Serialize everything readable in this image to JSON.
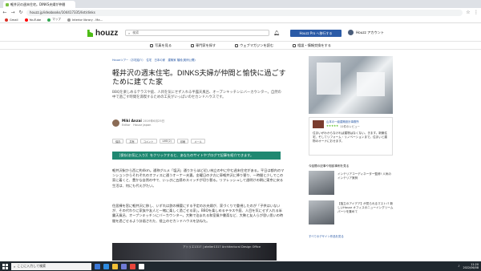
{
  "browser": {
    "tab_title": "軽井沢の週末住宅。DINKS夫婦が仲間",
    "url": "houzz.jp/ideabooks/104417335/list/dinks",
    "bookmarks": [
      "Gmail",
      "YouTube",
      "マップ",
      "Interior library - Ma..."
    ]
  },
  "header": {
    "logo": "houzz",
    "search_placeholder": "検索",
    "pro_button": "Houzz Pro へ移行する",
    "account_label": "Houzz アカウント"
  },
  "nav": {
    "items": [
      "写真を見る",
      "専門家を探す",
      "ウェブマガジンを読む",
      "相談・情報交換をする"
    ]
  },
  "article": {
    "breadcrumb": "Houzzツアー（お宅紹介）　住宅　日本の家　建築家 階段(実例公開)",
    "title": "軽井沢の週末住宅。DINKS夫婦が仲間と愉快に過ごすために建てた家",
    "subtitle": "BBQを楽しめるテラスや庭、人目を気にせず入れる半露天風呂、オープンキッチンにバーカウンター。自然の中で過ごす時間を満喫するための工夫がいっぱいのセカンドハウスです。",
    "author_name": "Miki Anzai",
    "author_date": "2019年6月25日",
    "author_role": "Editor　Houzz Japan",
    "actions": [
      "保存",
      "共有",
      "コメント",
      "LIKE(2)",
      "印刷",
      "メール"
    ],
    "banner": "［保存(お気に入り)］をクリックすると、あなたのサイトやブログで記事を紹介できます。",
    "para1": "軽井沢駅から西に約4km。通称グルメ「塩沢」通りからほど近い林立の中に佇む週末住宅がある。平日は都内のマンションからそれぞれのオフィスに通うオーナー夫妻。金曜日の夕方に車軽井沢に降り替り、一時間と少しでこの家に着くと、豊かな自然の中で、いっきに五感のスイッチが切り替る。リフレッシュして週明けの朝に東京に戻る生活は、何にも代えがたい。",
    "para2": "住居棟を窓に軽井沢に移し、いずれは鉄の棟要にする予定のお夫婦が、家づくりで重視したのが「子供はいないが、その代わりに家族や友人と一緒に楽しく過ごせる家」。BBQを楽しめるテラスや庭、人目を気にせず入れる半露天風呂、オープンキッチンにバーカウンター。大勢で泊まれる和室風や書斎など、大勢と友人らが思い思いの時間を過ごせるよう計画された、極上のセカンドハウスを訪ねた。",
    "image_caption": "アトリエ1317 | atelier1317 Architectural Design Office"
  },
  "sidebar": {
    "pro_name": "山本の一級建築設計事務所",
    "pro_reviews": "11件のレビュー",
    "pro_desc": "住まいがわからなければ建物はなくない。きます。新築住宅、そしてリフォーム・リノベーションまで。住まいと建物のオーナにおせます。",
    "section_head": "今話題の記事や相談事例を見る",
    "related": [
      {
        "text": "インテリアコーディネーター監修! 人気のインテリア実例"
      },
      {
        "text": "【独立のアイデア】が見られるマストバ 新しいHouzz オフィスのニューイングリームパーツを集めて"
      }
    ],
    "more_link": "すべてのデザイン作品を見る"
  },
  "taskbar": {
    "search_placeholder": "ここに入力して検索",
    "time": "11:20",
    "date": "2022/06/08"
  },
  "colors": {
    "brand_green": "#4dbc15",
    "pro_blue": "#2b5ba7",
    "banner_teal": "#1f8871"
  }
}
